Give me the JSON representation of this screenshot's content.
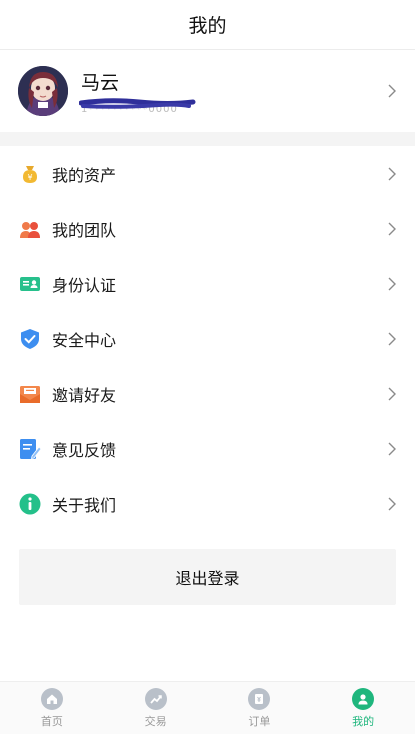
{
  "header": {
    "title": "我的"
  },
  "profile": {
    "name": "马云",
    "phone": "1**********0000"
  },
  "menu": [
    {
      "label": "我的资产",
      "icon": "money-bag-icon"
    },
    {
      "label": "我的团队",
      "icon": "team-icon"
    },
    {
      "label": "身份认证",
      "icon": "id-card-icon"
    },
    {
      "label": "安全中心",
      "icon": "shield-icon"
    },
    {
      "label": "邀请好友",
      "icon": "envelope-icon"
    },
    {
      "label": "意见反馈",
      "icon": "feedback-edit-icon"
    },
    {
      "label": "关于我们",
      "icon": "info-icon"
    }
  ],
  "logout": {
    "label": "退出登录"
  },
  "tabbar": {
    "tabs": [
      {
        "label": "首页",
        "icon": "home-icon"
      },
      {
        "label": "交易",
        "icon": "trade-chart-icon"
      },
      {
        "label": "订单",
        "icon": "order-icon"
      },
      {
        "label": "我的",
        "icon": "user-icon",
        "active": true
      }
    ]
  },
  "colors": {
    "accent": "#1fb67d",
    "tab_inactive": "#b9c0c9",
    "scribble": "#2f2f9a"
  }
}
